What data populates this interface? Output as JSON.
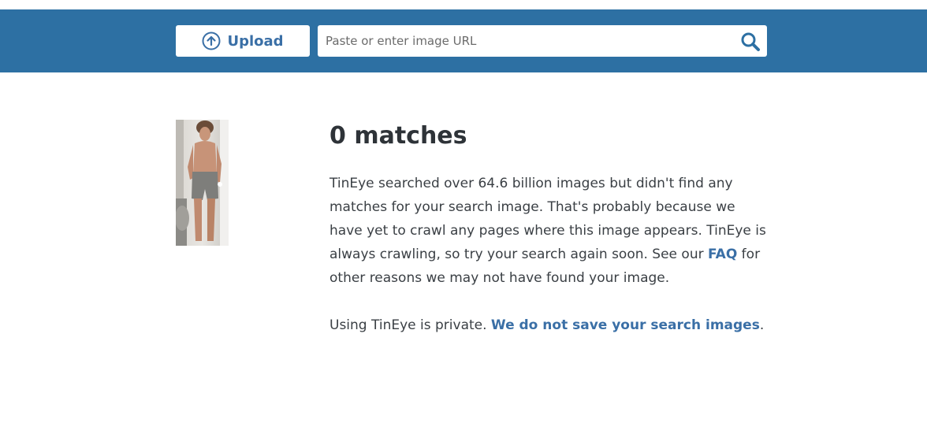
{
  "header": {
    "upload_label": "Upload",
    "search_placeholder": "Paste or enter image URL",
    "upload_icon": "upload-circle-arrow-icon",
    "search_icon": "magnifier-search-icon",
    "bar_color": "#2d70a3",
    "accent_color": "#3a6fa6"
  },
  "results": {
    "title": "0 matches",
    "message_before_link": "TinEye searched over 64.6 billion images but didn't find any matches for your search image. That's probably because we have yet to crawl any pages where this image appears. TinEye is always crawling, so try your search again soon. See our ",
    "faq_link": "FAQ",
    "message_after_link": " for other reasons we may not have found your image.",
    "privacy_before_link": "Using TinEye is private. ",
    "privacy_link": "We do not save your search images",
    "privacy_after_link": "."
  }
}
